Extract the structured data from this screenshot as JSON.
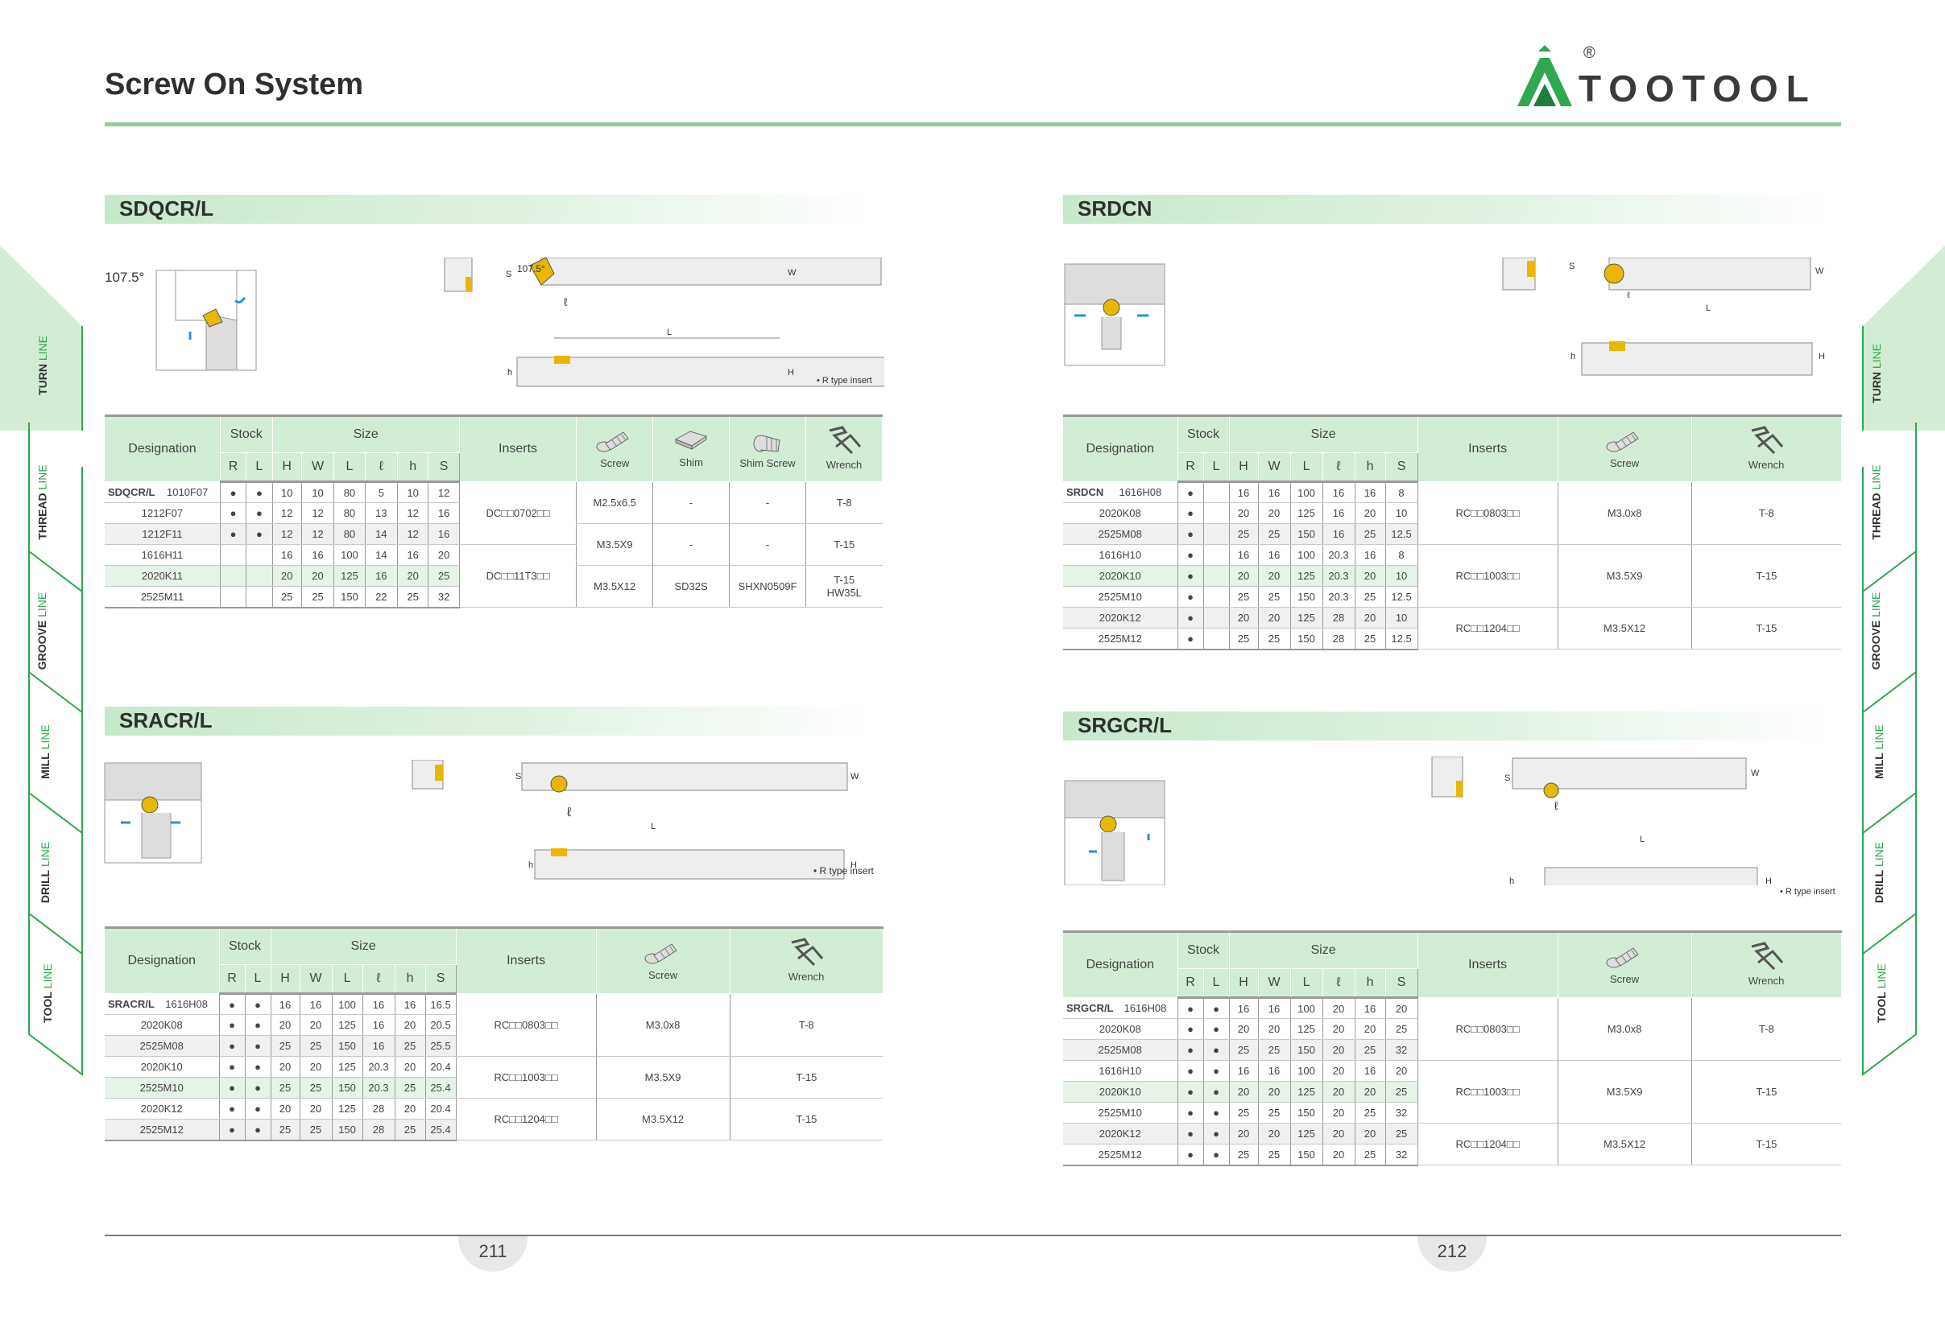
{
  "header": {
    "title": "Screw On System",
    "brand": "TOOTOOL",
    "registered": "®"
  },
  "tabs_left": [
    {
      "bold": "TURN",
      "light": "LINE"
    },
    {
      "bold": "THREAD",
      "light": "LINE"
    },
    {
      "bold": "GROOVE",
      "light": "LINE"
    },
    {
      "bold": "MILL",
      "light": "LINE"
    },
    {
      "bold": "DRILL",
      "light": "LINE"
    },
    {
      "bold": "TOOL",
      "light": "LINE"
    }
  ],
  "tabs_right": [
    {
      "bold": "TURN",
      "light": "LINE"
    },
    {
      "bold": "THREAD",
      "light": "LINE"
    },
    {
      "bold": "GROOVE",
      "light": "LINE"
    },
    {
      "bold": "MILL",
      "light": "LINE"
    },
    {
      "bold": "DRILL",
      "light": "LINE"
    },
    {
      "bold": "TOOL",
      "light": "LINE"
    }
  ],
  "headers": {
    "designation": "Designation",
    "stock": "Stock",
    "size": "Size",
    "inserts": "Inserts",
    "screw": "Screw",
    "shim": "Shim",
    "shim_screw": "Shim Screw",
    "wrench": "Wrench",
    "r": "R",
    "l": "L",
    "h_up": "H",
    "w": "W",
    "l_up": "L",
    "ell": "ℓ",
    "h": "h",
    "s": "S"
  },
  "drawing_labels": {
    "angle": "107.5°",
    "r_type": "• R type insert",
    "S": "S",
    "W": "W",
    "L": "L",
    "ell": "ℓ",
    "h": "h",
    "H": "H"
  },
  "sections": {
    "sdqcr": {
      "name": "SDQCR/L",
      "rows": [
        {
          "prefix": "SDQCR/L",
          "code": "1010F07",
          "r": "●",
          "l": "●",
          "H": "10",
          "W": "10",
          "L": "80",
          "ell": "5",
          "h": "10",
          "S": "12"
        },
        {
          "prefix": "",
          "code": "1212F07",
          "r": "●",
          "l": "●",
          "H": "12",
          "W": "12",
          "L": "80",
          "ell": "13",
          "h": "12",
          "S": "16"
        },
        {
          "prefix": "",
          "code": "1212F11",
          "r": "●",
          "l": "●",
          "H": "12",
          "W": "12",
          "L": "80",
          "ell": "14",
          "h": "12",
          "S": "16"
        },
        {
          "prefix": "",
          "code": "1616H11",
          "r": "",
          "l": "",
          "H": "16",
          "W": "16",
          "L": "100",
          "ell": "14",
          "h": "16",
          "S": "20"
        },
        {
          "prefix": "",
          "code": "2020K11",
          "r": "",
          "l": "",
          "H": "20",
          "W": "20",
          "L": "125",
          "ell": "16",
          "h": "20",
          "S": "25"
        },
        {
          "prefix": "",
          "code": "2525M11",
          "r": "",
          "l": "",
          "H": "25",
          "W": "25",
          "L": "150",
          "ell": "22",
          "h": "25",
          "S": "32"
        }
      ],
      "groups": [
        {
          "insert": "DC□□0702□□",
          "screw": "M2.5x6.5",
          "shim": "-",
          "shim_screw": "-",
          "wrench": "T-8"
        },
        {
          "insert": "DC□□11T3□□",
          "screw": "M3.5X9",
          "shim": "-",
          "shim_screw": "-",
          "wrench": "T-15"
        },
        {
          "screw": "M3.5X12",
          "shim": "SD32S",
          "shim_screw": "SHXN0509F",
          "wrench": "T-15\nHW35L"
        }
      ]
    },
    "srdcn": {
      "name": "SRDCN",
      "rows": [
        {
          "prefix": "SRDCN",
          "code": "1616H08",
          "r": "●",
          "l": "",
          "H": "16",
          "W": "16",
          "L": "100",
          "ell": "16",
          "h": "16",
          "S": "8"
        },
        {
          "prefix": "",
          "code": "2020K08",
          "r": "●",
          "l": "",
          "H": "20",
          "W": "20",
          "L": "125",
          "ell": "16",
          "h": "20",
          "S": "10"
        },
        {
          "prefix": "",
          "code": "2525M08",
          "r": "●",
          "l": "",
          "H": "25",
          "W": "25",
          "L": "150",
          "ell": "16",
          "h": "25",
          "S": "12.5"
        },
        {
          "prefix": "",
          "code": "1616H10",
          "r": "●",
          "l": "",
          "H": "16",
          "W": "16",
          "L": "100",
          "ell": "20.3",
          "h": "16",
          "S": "8"
        },
        {
          "prefix": "",
          "code": "2020K10",
          "r": "●",
          "l": "",
          "H": "20",
          "W": "20",
          "L": "125",
          "ell": "20.3",
          "h": "20",
          "S": "10"
        },
        {
          "prefix": "",
          "code": "2525M10",
          "r": "●",
          "l": "",
          "H": "25",
          "W": "25",
          "L": "150",
          "ell": "20.3",
          "h": "25",
          "S": "12.5"
        },
        {
          "prefix": "",
          "code": "2020K12",
          "r": "●",
          "l": "",
          "H": "20",
          "W": "20",
          "L": "125",
          "ell": "28",
          "h": "20",
          "S": "10"
        },
        {
          "prefix": "",
          "code": "2525M12",
          "r": "●",
          "l": "",
          "H": "25",
          "W": "25",
          "L": "150",
          "ell": "28",
          "h": "25",
          "S": "12.5"
        }
      ],
      "groups": [
        {
          "insert": "RC□□0803□□",
          "screw": "M3.0x8",
          "wrench": "T-8"
        },
        {
          "insert": "RC□□1003□□",
          "screw": "M3.5X9",
          "wrench": "T-15"
        },
        {
          "insert": "RC□□1204□□",
          "screw": "M3.5X12",
          "wrench": "T-15"
        }
      ]
    },
    "sracr": {
      "name": "SRACR/L",
      "rows": [
        {
          "prefix": "SRACR/L",
          "code": "1616H08",
          "r": "●",
          "l": "●",
          "H": "16",
          "W": "16",
          "L": "100",
          "ell": "16",
          "h": "16",
          "S": "16.5"
        },
        {
          "prefix": "",
          "code": "2020K08",
          "r": "●",
          "l": "●",
          "H": "20",
          "W": "20",
          "L": "125",
          "ell": "16",
          "h": "20",
          "S": "20.5"
        },
        {
          "prefix": "",
          "code": "2525M08",
          "r": "●",
          "l": "●",
          "H": "25",
          "W": "25",
          "L": "150",
          "ell": "16",
          "h": "25",
          "S": "25.5"
        },
        {
          "prefix": "",
          "code": "2020K10",
          "r": "●",
          "l": "●",
          "H": "20",
          "W": "20",
          "L": "125",
          "ell": "20.3",
          "h": "20",
          "S": "20.4"
        },
        {
          "prefix": "",
          "code": "2525M10",
          "r": "●",
          "l": "●",
          "H": "25",
          "W": "25",
          "L": "150",
          "ell": "20.3",
          "h": "25",
          "S": "25.4"
        },
        {
          "prefix": "",
          "code": "2020K12",
          "r": "●",
          "l": "●",
          "H": "20",
          "W": "20",
          "L": "125",
          "ell": "28",
          "h": "20",
          "S": "20.4"
        },
        {
          "prefix": "",
          "code": "2525M12",
          "r": "●",
          "l": "●",
          "H": "25",
          "W": "25",
          "L": "150",
          "ell": "28",
          "h": "25",
          "S": "25.4"
        }
      ],
      "groups": [
        {
          "insert": "RC□□0803□□",
          "screw": "M3.0x8",
          "wrench": "T-8"
        },
        {
          "insert": "RC□□1003□□",
          "screw": "M3.5X9",
          "wrench": "T-15"
        },
        {
          "insert": "RC□□1204□□",
          "screw": "M3.5X12",
          "wrench": "T-15"
        }
      ]
    },
    "srgcr": {
      "name": "SRGCR/L",
      "rows": [
        {
          "prefix": "SRGCR/L",
          "code": "1616H08",
          "r": "●",
          "l": "●",
          "H": "16",
          "W": "16",
          "L": "100",
          "ell": "20",
          "h": "16",
          "S": "20"
        },
        {
          "prefix": "",
          "code": "2020K08",
          "r": "●",
          "l": "●",
          "H": "20",
          "W": "20",
          "L": "125",
          "ell": "20",
          "h": "20",
          "S": "25"
        },
        {
          "prefix": "",
          "code": "2525M08",
          "r": "●",
          "l": "●",
          "H": "25",
          "W": "25",
          "L": "150",
          "ell": "20",
          "h": "25",
          "S": "32"
        },
        {
          "prefix": "",
          "code": "1616H10",
          "r": "●",
          "l": "●",
          "H": "16",
          "W": "16",
          "L": "100",
          "ell": "20",
          "h": "16",
          "S": "20"
        },
        {
          "prefix": "",
          "code": "2020K10",
          "r": "●",
          "l": "●",
          "H": "20",
          "W": "20",
          "L": "125",
          "ell": "20",
          "h": "20",
          "S": "25"
        },
        {
          "prefix": "",
          "code": "2525M10",
          "r": "●",
          "l": "●",
          "H": "25",
          "W": "25",
          "L": "150",
          "ell": "20",
          "h": "25",
          "S": "32"
        },
        {
          "prefix": "",
          "code": "2020K12",
          "r": "●",
          "l": "●",
          "H": "20",
          "W": "20",
          "L": "125",
          "ell": "20",
          "h": "20",
          "S": "25"
        },
        {
          "prefix": "",
          "code": "2525M12",
          "r": "●",
          "l": "●",
          "H": "25",
          "W": "25",
          "L": "150",
          "ell": "20",
          "h": "25",
          "S": "32"
        }
      ],
      "groups": [
        {
          "insert": "RC□□0803□□",
          "screw": "M3.0x8",
          "wrench": "T-8"
        },
        {
          "insert": "RC□□1003□□",
          "screw": "M3.5X9",
          "wrench": "T-15"
        },
        {
          "insert": "RC□□1204□□",
          "screw": "M3.5X12",
          "wrench": "T-15"
        }
      ]
    }
  },
  "pages": {
    "left": "211",
    "right": "212"
  },
  "colors": {
    "brand_green": "#2fa84f",
    "table_header": "#d3ecd6",
    "insert_gold": "#e8b800",
    "arrow_blue": "#2b8fd6"
  }
}
